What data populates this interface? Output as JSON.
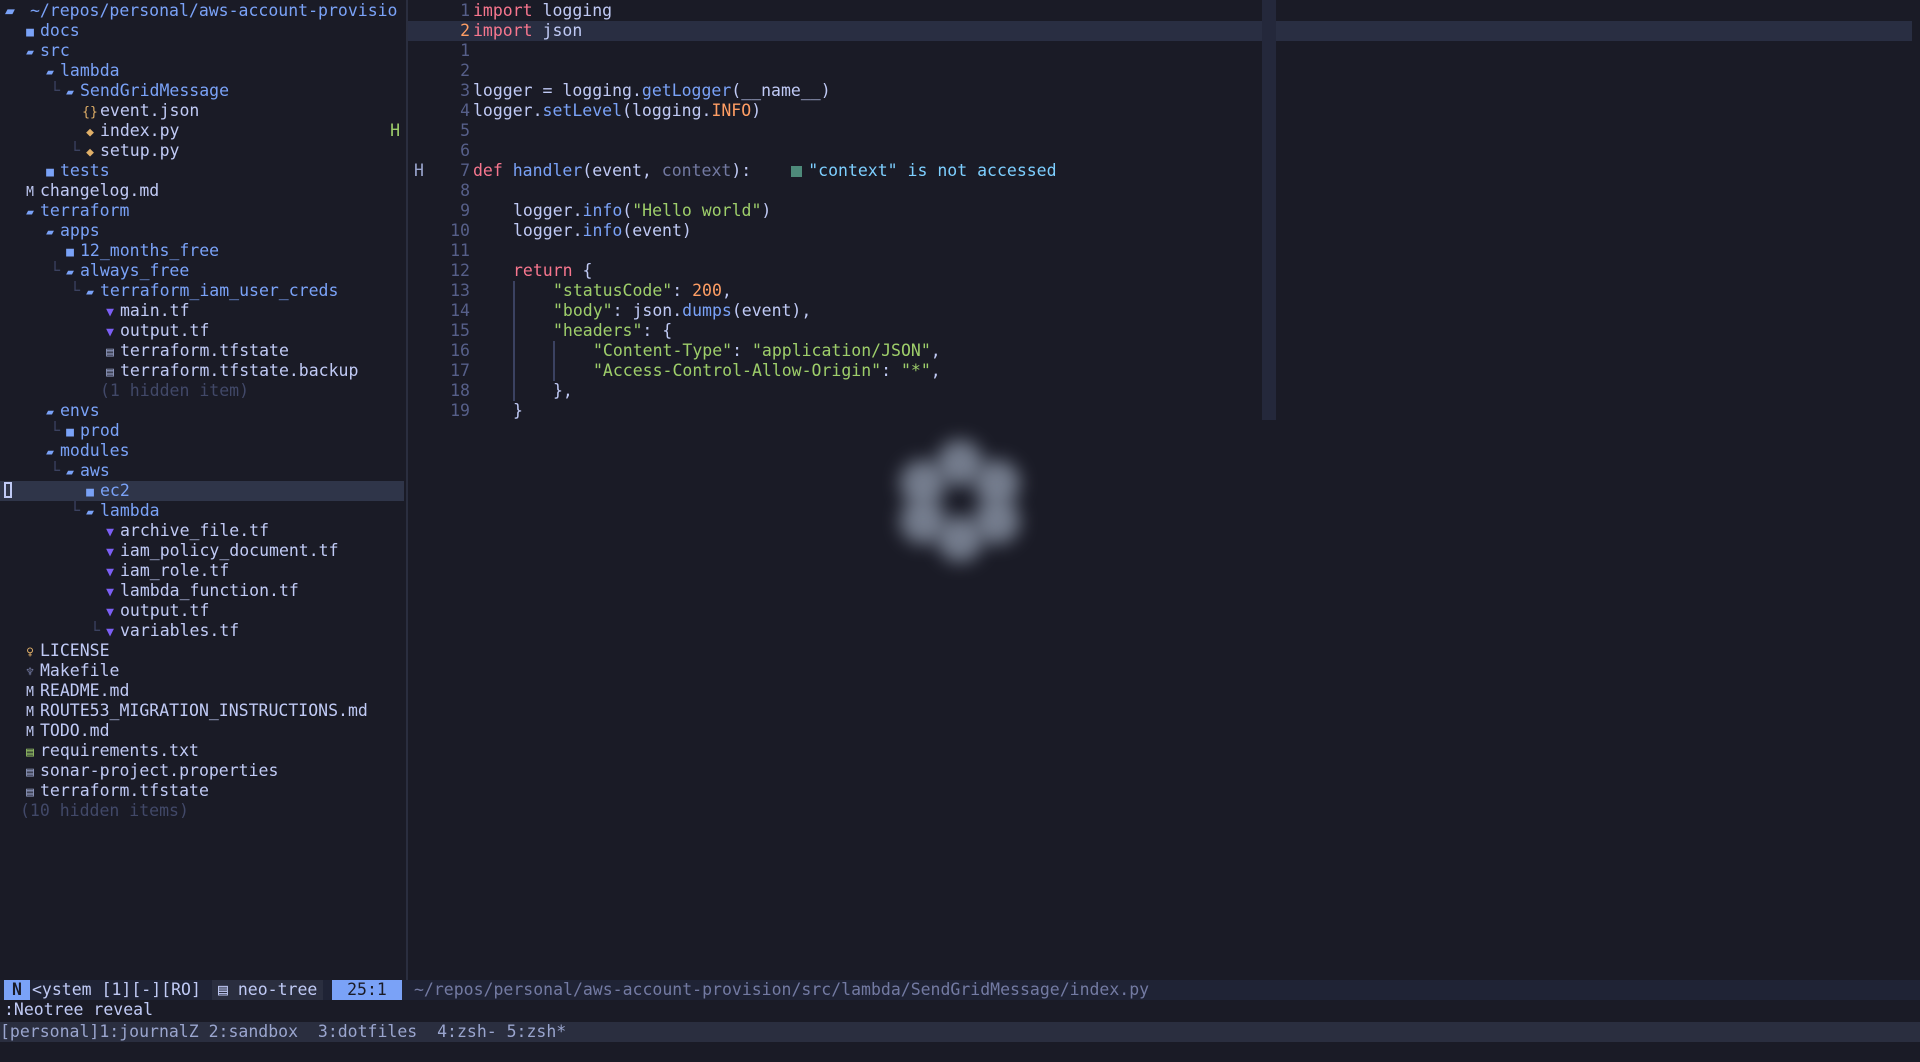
{
  "tree": {
    "root": "~/repos/personal/aws-account-provisio",
    "rows": [
      {
        "indent": 1,
        "guide": "",
        "type": "dir",
        "icon": "folder-closed-icon",
        "name": "docs"
      },
      {
        "indent": 1,
        "guide": "",
        "type": "dir",
        "icon": "folder-open-icon",
        "name": "src"
      },
      {
        "indent": 2,
        "guide": "",
        "type": "dir",
        "icon": "folder-open-icon",
        "name": "lambda"
      },
      {
        "indent": 3,
        "guide": "└",
        "type": "dir",
        "icon": "folder-open-icon",
        "name": "SendGridMessage"
      },
      {
        "indent": 4,
        "guide": "",
        "type": "file",
        "icon": "json-icon",
        "name": "event.json"
      },
      {
        "indent": 4,
        "guide": "",
        "type": "file",
        "icon": "python-icon",
        "name": "index.py",
        "flag": "H"
      },
      {
        "indent": 4,
        "guide": "└",
        "type": "file",
        "icon": "python-icon",
        "name": "setup.py"
      },
      {
        "indent": 2,
        "guide": "",
        "type": "dir",
        "icon": "folder-closed-icon",
        "name": "tests"
      },
      {
        "indent": 1,
        "guide": "",
        "type": "file",
        "icon": "markdown-icon",
        "name": "changelog.md"
      },
      {
        "indent": 1,
        "guide": "",
        "type": "dir",
        "icon": "folder-open-icon",
        "name": "terraform"
      },
      {
        "indent": 2,
        "guide": "",
        "type": "dir",
        "icon": "folder-open-icon",
        "name": "apps"
      },
      {
        "indent": 3,
        "guide": "",
        "type": "dir",
        "icon": "folder-closed-icon",
        "name": "12_months_free"
      },
      {
        "indent": 3,
        "guide": "└",
        "type": "dir",
        "icon": "folder-open-icon",
        "name": "always_free"
      },
      {
        "indent": 4,
        "guide": "└",
        "type": "dir",
        "icon": "folder-open-icon",
        "name": "terraform_iam_user_creds"
      },
      {
        "indent": 5,
        "guide": "",
        "type": "file",
        "icon": "terraform-icon",
        "name": "main.tf"
      },
      {
        "indent": 5,
        "guide": "",
        "type": "file",
        "icon": "terraform-icon",
        "name": "output.tf"
      },
      {
        "indent": 5,
        "guide": "",
        "type": "file",
        "icon": "file-icon",
        "name": "terraform.tfstate"
      },
      {
        "indent": 5,
        "guide": "",
        "type": "file",
        "icon": "file-icon",
        "name": "terraform.tfstate.backup"
      },
      {
        "indent": 5,
        "guide": "",
        "type": "hidden",
        "icon": "",
        "name": "(1 hidden item)"
      },
      {
        "indent": 2,
        "guide": "",
        "type": "dir",
        "icon": "folder-open-icon",
        "name": "envs"
      },
      {
        "indent": 3,
        "guide": "└",
        "type": "dir",
        "icon": "folder-closed-icon",
        "name": "prod"
      },
      {
        "indent": 2,
        "guide": "",
        "type": "dir",
        "icon": "folder-open-icon",
        "name": "modules"
      },
      {
        "indent": 3,
        "guide": "└",
        "type": "dir",
        "icon": "folder-open-icon",
        "name": "aws"
      },
      {
        "indent": 4,
        "guide": "",
        "type": "dir",
        "icon": "folder-closed-icon",
        "name": "ec2",
        "selected": true
      },
      {
        "indent": 4,
        "guide": "└",
        "type": "dir",
        "icon": "folder-open-icon",
        "name": "lambda"
      },
      {
        "indent": 5,
        "guide": "",
        "type": "file",
        "icon": "terraform-icon",
        "name": "archive_file.tf"
      },
      {
        "indent": 5,
        "guide": "",
        "type": "file",
        "icon": "terraform-icon",
        "name": "iam_policy_document.tf"
      },
      {
        "indent": 5,
        "guide": "",
        "type": "file",
        "icon": "terraform-icon",
        "name": "iam_role.tf"
      },
      {
        "indent": 5,
        "guide": "",
        "type": "file",
        "icon": "terraform-icon",
        "name": "lambda_function.tf"
      },
      {
        "indent": 5,
        "guide": "",
        "type": "file",
        "icon": "terraform-icon",
        "name": "output.tf"
      },
      {
        "indent": 5,
        "guide": "└",
        "type": "file",
        "icon": "terraform-icon",
        "name": "variables.tf"
      },
      {
        "indent": 1,
        "guide": "",
        "type": "file",
        "icon": "license-icon",
        "name": "LICENSE"
      },
      {
        "indent": 1,
        "guide": "",
        "type": "file",
        "icon": "makefile-icon",
        "name": "Makefile"
      },
      {
        "indent": 1,
        "guide": "",
        "type": "file",
        "icon": "markdown-icon",
        "name": "README.md"
      },
      {
        "indent": 1,
        "guide": "",
        "type": "file",
        "icon": "markdown-icon",
        "name": "ROUTE53_MIGRATION_INSTRUCTIONS.md"
      },
      {
        "indent": 1,
        "guide": "",
        "type": "file",
        "icon": "markdown-icon",
        "name": "TODO.md"
      },
      {
        "indent": 1,
        "guide": "",
        "type": "file",
        "icon": "text-file-icon",
        "name": "requirements.txt"
      },
      {
        "indent": 1,
        "guide": "",
        "type": "file",
        "icon": "file-icon",
        "name": "sonar-project.properties"
      },
      {
        "indent": 1,
        "guide": "",
        "type": "file",
        "icon": "file-icon",
        "name": "terraform.tfstate"
      },
      {
        "indent": 1,
        "guide": "",
        "type": "hidden",
        "icon": "",
        "name": "(10 hidden items)"
      }
    ]
  },
  "editor": {
    "lines": [
      {
        "num": "1",
        "tokens": [
          [
            "kw",
            "import"
          ],
          [
            "",
            "logging"
          ]
        ]
      },
      {
        "num": "2",
        "current": true,
        "tokens": [
          [
            "kw",
            "import"
          ],
          [
            "",
            "json"
          ]
        ]
      },
      {
        "num": "1",
        "tokens": []
      },
      {
        "num": "2",
        "tokens": []
      },
      {
        "num": "3",
        "tokens": [
          [
            "",
            "logger = logging."
          ],
          [
            "fn",
            "getLogger"
          ],
          [
            "",
            "(__name__)"
          ]
        ]
      },
      {
        "num": "4",
        "tokens": [
          [
            "",
            "logger."
          ],
          [
            "fn",
            "setLevel"
          ],
          [
            "",
            "(logging."
          ],
          [
            "const",
            "INFO"
          ],
          [
            "",
            ")"
          ]
        ]
      },
      {
        "num": "5",
        "tokens": []
      },
      {
        "num": "6",
        "tokens": []
      },
      {
        "num": "7",
        "sign": "H",
        "tokens": [
          [
            "kw",
            "def"
          ],
          [
            "fn",
            "handler"
          ],
          [
            "",
            "(event, "
          ],
          [
            "dim",
            "context"
          ],
          [
            "",
            "):"
          ]
        ],
        "diagnostic": "\"context\" is not accessed"
      },
      {
        "num": "8",
        "tokens": []
      },
      {
        "num": "9",
        "indent": 1,
        "tokens": [
          [
            "",
            "logger."
          ],
          [
            "fn",
            "info"
          ],
          [
            "",
            "("
          ],
          [
            "str",
            "\"Hello world\""
          ],
          [
            "",
            ")"
          ]
        ]
      },
      {
        "num": "10",
        "indent": 1,
        "tokens": [
          [
            "",
            "logger."
          ],
          [
            "fn",
            "info"
          ],
          [
            "",
            "(event)"
          ]
        ]
      },
      {
        "num": "11",
        "tokens": []
      },
      {
        "num": "12",
        "indent": 1,
        "tokens": [
          [
            "kw",
            "return"
          ],
          [
            "",
            "{"
          ]
        ]
      },
      {
        "num": "13",
        "indent": 2,
        "tokens": [
          [
            "str",
            "\"statusCode\""
          ],
          [
            "",
            ": "
          ],
          [
            "num",
            "200"
          ],
          [
            "",
            ","
          ]
        ]
      },
      {
        "num": "14",
        "indent": 2,
        "tokens": [
          [
            "str",
            "\"body\""
          ],
          [
            "",
            ": json."
          ],
          [
            "fn",
            "dumps"
          ],
          [
            "",
            "(event),"
          ]
        ]
      },
      {
        "num": "15",
        "indent": 2,
        "tokens": [
          [
            "str",
            "\"headers\""
          ],
          [
            "",
            ": {"
          ]
        ]
      },
      {
        "num": "16",
        "indent": 3,
        "tokens": [
          [
            "str",
            "\"Content-Type\""
          ],
          [
            "",
            ": "
          ],
          [
            "str",
            "\"application/JSON\""
          ],
          [
            "",
            ","
          ]
        ]
      },
      {
        "num": "17",
        "indent": 3,
        "tokens": [
          [
            "str",
            "\"Access-Control-Allow-Origin\""
          ],
          [
            "",
            ": "
          ],
          [
            "str",
            "\"*\""
          ],
          [
            "",
            ","
          ]
        ]
      },
      {
        "num": "18",
        "indent": 2,
        "tokens": [
          [
            "",
            "},"
          ]
        ]
      },
      {
        "num": "19",
        "indent": 1,
        "tokens": [
          [
            "",
            "}"
          ]
        ]
      }
    ]
  },
  "status": {
    "mode": "N",
    "buffer": "<ystem [1][-][RO]",
    "filetype_icon": "file-icon",
    "filetype": "neo-tree",
    "position": "25:1",
    "path": "~/repos/personal/aws-account-provision/src/lambda/SendGridMessage/index.py"
  },
  "cmdline": ":Neotree reveal",
  "tmux": "[personal]1:journalZ 2:sandbox  3:dotfiles  4:zsh- 5:zsh*",
  "colors": {
    "background": "#1a1b26",
    "accent": "#7aa2f7",
    "keyword": "#f7768e",
    "string": "#9ece6a",
    "number": "#ff9e64"
  }
}
